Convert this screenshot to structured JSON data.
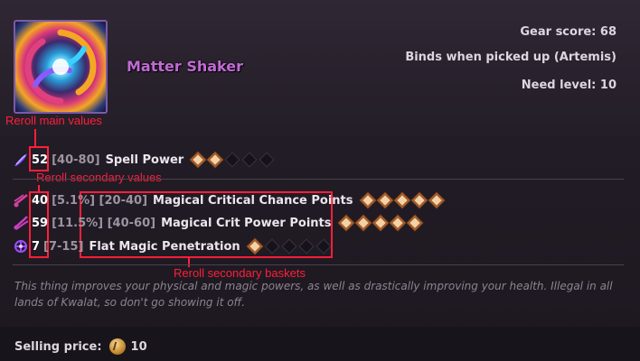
{
  "item": {
    "name": "Matter Shaker",
    "gear_score_label": "Gear score:",
    "gear_score_value": "68",
    "binds": "Binds when picked up (Artemis)",
    "need_level_label": "Need level:",
    "need_level_value": "10",
    "icon": "matter-shaker-icon"
  },
  "main_stat": {
    "value": "52",
    "range": "[40-80]",
    "name": "Spell Power",
    "filled": 2,
    "total": 5,
    "icon": "spell-power-icon"
  },
  "secondary_stats": [
    {
      "value": "40",
      "range": "[5.1%] [20-40]",
      "name": "Magical Critical Chance Points",
      "filled": 5,
      "total": 5,
      "icon": "crit-chance-icon"
    },
    {
      "value": "59",
      "range": "[11.5%] [40-60]",
      "name": "Magical Crit Power Points",
      "filled": 5,
      "total": 5,
      "icon": "crit-power-icon"
    },
    {
      "value": "7",
      "range": "[7-15]",
      "name": "Flat Magic Penetration",
      "filled": 1,
      "total": 5,
      "icon": "magic-penetration-icon"
    }
  ],
  "description": "This thing improves your physical and magic powers, as well as drastically improving your health. Illegal in all lands of Kwalat, so don't go showing it off.",
  "footer": {
    "selling_price_label": "Selling price:",
    "selling_price_value": "10",
    "icon": "coin-icon"
  },
  "annotations": {
    "main": "Reroll main values",
    "secondary": "Reroll secondary values",
    "baskets": "Reroll secondary baskets"
  },
  "colors": {
    "item_name": "#c26ad6",
    "annotation": "#ff1f3a",
    "diamond_filled": "#f3d2a6",
    "diamond_border": "#a35a2a"
  }
}
